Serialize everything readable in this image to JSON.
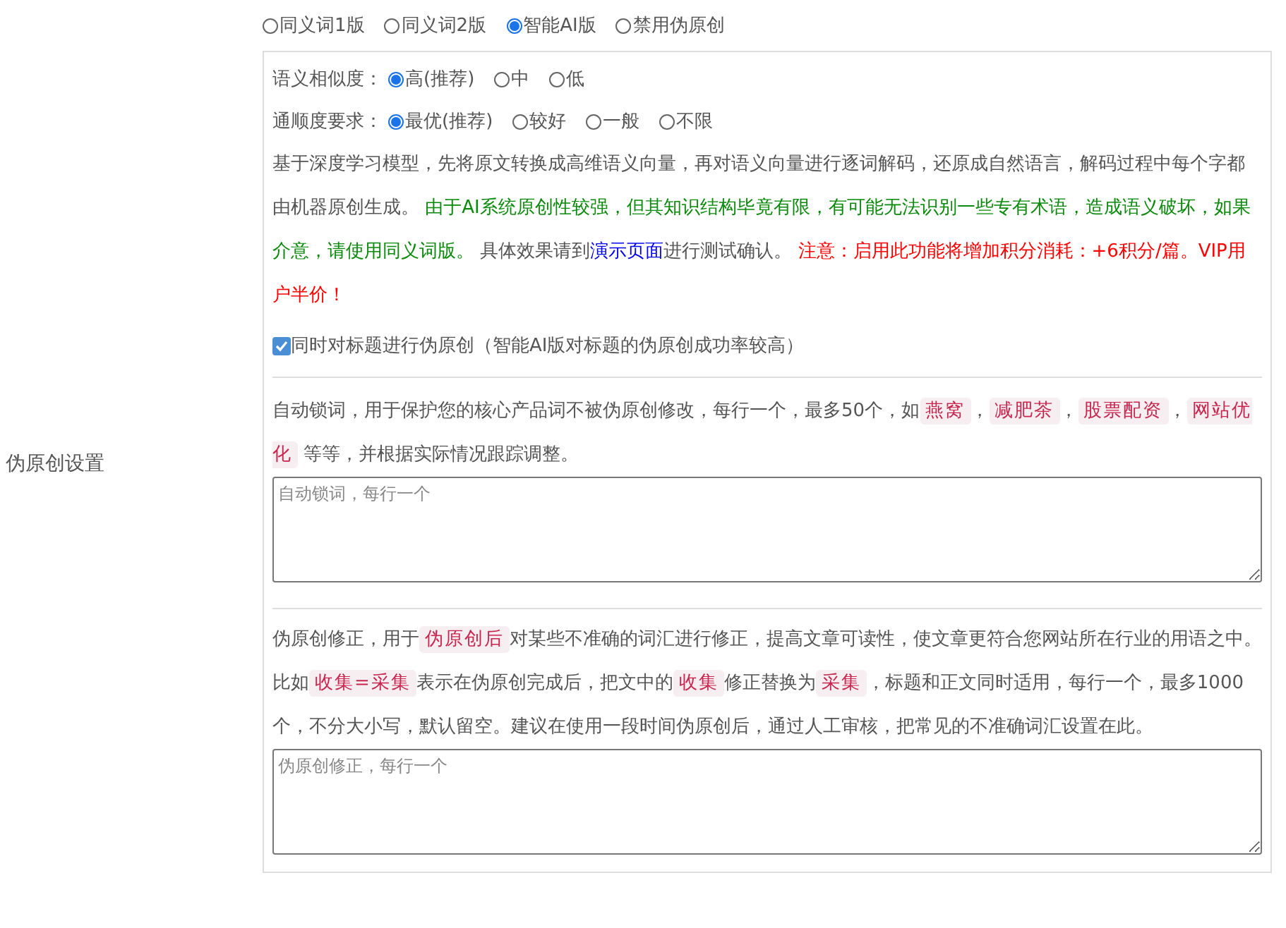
{
  "section_label": "伪原创设置",
  "modes": [
    {
      "label": "同义词1版",
      "selected": false
    },
    {
      "label": "同义词2版",
      "selected": false
    },
    {
      "label": "智能AI版",
      "selected": true
    },
    {
      "label": "禁用伪原创",
      "selected": false
    }
  ],
  "settings": [
    {
      "label": "语义相似度：",
      "options": [
        {
          "label": "高(推荐)",
          "selected": true
        },
        {
          "label": "中",
          "selected": false
        },
        {
          "label": "低",
          "selected": false
        }
      ]
    },
    {
      "label": "通顺度要求：",
      "options": [
        {
          "label": "最优(推荐)",
          "selected": true
        },
        {
          "label": "较好",
          "selected": false
        },
        {
          "label": "一般",
          "selected": false
        },
        {
          "label": "不限",
          "selected": false
        }
      ]
    }
  ],
  "ai_description": [
    {
      "kind": "plain",
      "text": "基于深度学习模型，先将原文转换成高维语义向量，再对语义向量进行逐词解码，还原成自然语言，解码过程中每个字都由机器原创生成。 "
    },
    {
      "kind": "note",
      "text": "由于AI系统原创性较强，但其知识结构毕竟有限，有可能无法识别一些专有术语，造成语义破坏，如果介意，请使用同义词版。"
    },
    {
      "kind": "plain",
      "text": " 具体效果请到"
    },
    {
      "kind": "link",
      "text": "演示页面"
    },
    {
      "kind": "plain",
      "text": "进行测试确认。 "
    },
    {
      "kind": "warning",
      "text": "注意：启用此功能将增加积分消耗：+6积分/篇。VIP用户半价！"
    }
  ],
  "title_option": {
    "label": "同时对标题进行伪原创（智能AI版对标题的伪原创成功率较高）",
    "checked": true
  },
  "lock_words": {
    "description": [
      {
        "kind": "plain",
        "text": "自动锁词，用于保护您的核心产品词不被伪原创修改，每行一个，最多50个，如"
      },
      {
        "kind": "tag",
        "text": "燕窝"
      },
      {
        "kind": "plain",
        "text": "，"
      },
      {
        "kind": "tag",
        "text": "减肥茶"
      },
      {
        "kind": "plain",
        "text": "，"
      },
      {
        "kind": "tag",
        "text": "股票配资"
      },
      {
        "kind": "plain",
        "text": "，"
      },
      {
        "kind": "tag",
        "text": "网站优化"
      },
      {
        "kind": "plain",
        "text": " 等等，并根据实际情况跟踪调整。"
      }
    ],
    "placeholder": "自动锁词，每行一个"
  },
  "corrections": {
    "description": [
      {
        "kind": "plain",
        "text": "伪原创修正，用于"
      },
      {
        "kind": "tag",
        "text": "伪原创后"
      },
      {
        "kind": "plain",
        "text": "对某些不准确的词汇进行修正，提高文章可读性，使文章更符合您网站所在行业的用语之中。比如"
      },
      {
        "kind": "tag",
        "text": "收集=采集"
      },
      {
        "kind": "plain",
        "text": "表示在伪原创完成后，把文中的"
      },
      {
        "kind": "tag",
        "text": "收集"
      },
      {
        "kind": "plain",
        "text": "修正替换为"
      },
      {
        "kind": "tag",
        "text": "采集"
      },
      {
        "kind": "plain",
        "text": "，标题和正文同时适用，每行一个，最多1000个，不分大小写，默认留空。建议在使用一段时间伪原创后，通过人工审核，把常见的不准确词汇设置在此。"
      }
    ],
    "placeholder": "伪原创修正，每行一个"
  }
}
